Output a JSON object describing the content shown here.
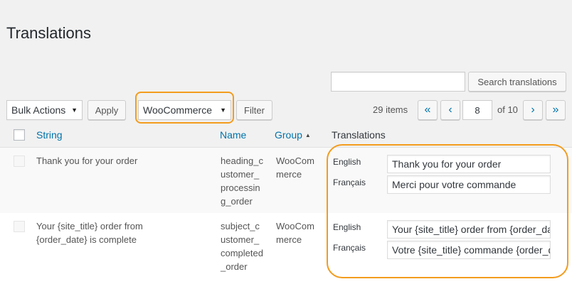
{
  "page": {
    "title": "Translations"
  },
  "search": {
    "button_label": "Search translations",
    "value": ""
  },
  "toolbar": {
    "bulk_actions": "Bulk Actions",
    "apply_label": "Apply",
    "group_filter": "WooCommerce",
    "filter_label": "Filter"
  },
  "pagination": {
    "items": "29 items",
    "first": "«",
    "prev": "‹",
    "current_page": "8",
    "of_total": "of 10",
    "next": "›",
    "last": "»"
  },
  "table": {
    "columns": {
      "string": "String",
      "name": "Name",
      "group": "Group",
      "translations": "Translations"
    },
    "sort_indicator": "▲",
    "rows": [
      {
        "string": "Thank you for your order",
        "name": "heading_customer_processing_order",
        "group": "WooCommerce",
        "translations": [
          {
            "lang": "English",
            "value": "Thank you for your order"
          },
          {
            "lang": "Français",
            "value": "Merci pour votre commande"
          }
        ]
      },
      {
        "string": "Your {site_title} order from {order_date} is complete",
        "name": "subject_customer_completed_order",
        "group": "WooCommerce",
        "translations": [
          {
            "lang": "English",
            "value": "Your {site_title} order from {order_date} is complete"
          },
          {
            "lang": "Français",
            "value": "Votre {site_title} commande {order_date} est terminée"
          }
        ]
      }
    ]
  },
  "colors": {
    "link": "#0073aa",
    "highlight": "#f39c1d",
    "background": "#f1f1f1"
  }
}
